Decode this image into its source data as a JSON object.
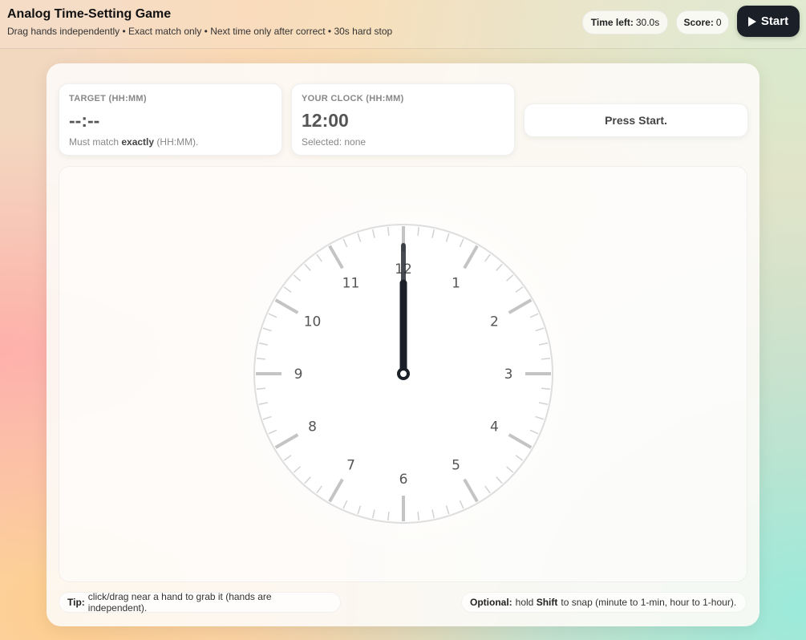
{
  "header": {
    "title": "Analog Time-Setting Game",
    "subtitle": "Drag hands independently • Exact match only • Next time only after correct • 30s hard stop",
    "time_left_label": "Time left:",
    "time_left_value": "30.0s",
    "score_label": "Score:",
    "score_value": "0",
    "start_label": "Start"
  },
  "target": {
    "label": "TARGET (HH:MM)",
    "value": "--:--",
    "note_prefix": "Must match",
    "note_emphasis": "exactly",
    "note_suffix": "(HH:MM)."
  },
  "your_clock": {
    "label": "YOUR CLOCK (HH:MM)",
    "value": "12:00",
    "selected_text": "Selected: none"
  },
  "status": {
    "message": "Press Start."
  },
  "clock": {
    "numbers": [
      "12",
      "1",
      "2",
      "3",
      "4",
      "5",
      "6",
      "7",
      "8",
      "9",
      "10",
      "11"
    ],
    "hour": 12,
    "minute": 0
  },
  "tips": {
    "tip_label": "Tip:",
    "tip_text": "click/drag near a hand to grab it (hands are independent).",
    "optional_label": "Optional:",
    "optional_pre": "hold",
    "optional_key": "Shift",
    "optional_post": "to snap (minute to 1-min, hour to 1-hour)."
  },
  "colors": {
    "hand": "#1b2028",
    "tick_major": "#c4c4c4",
    "tick_minor": "#d2d2d2",
    "start_bg": "#1b2028"
  }
}
